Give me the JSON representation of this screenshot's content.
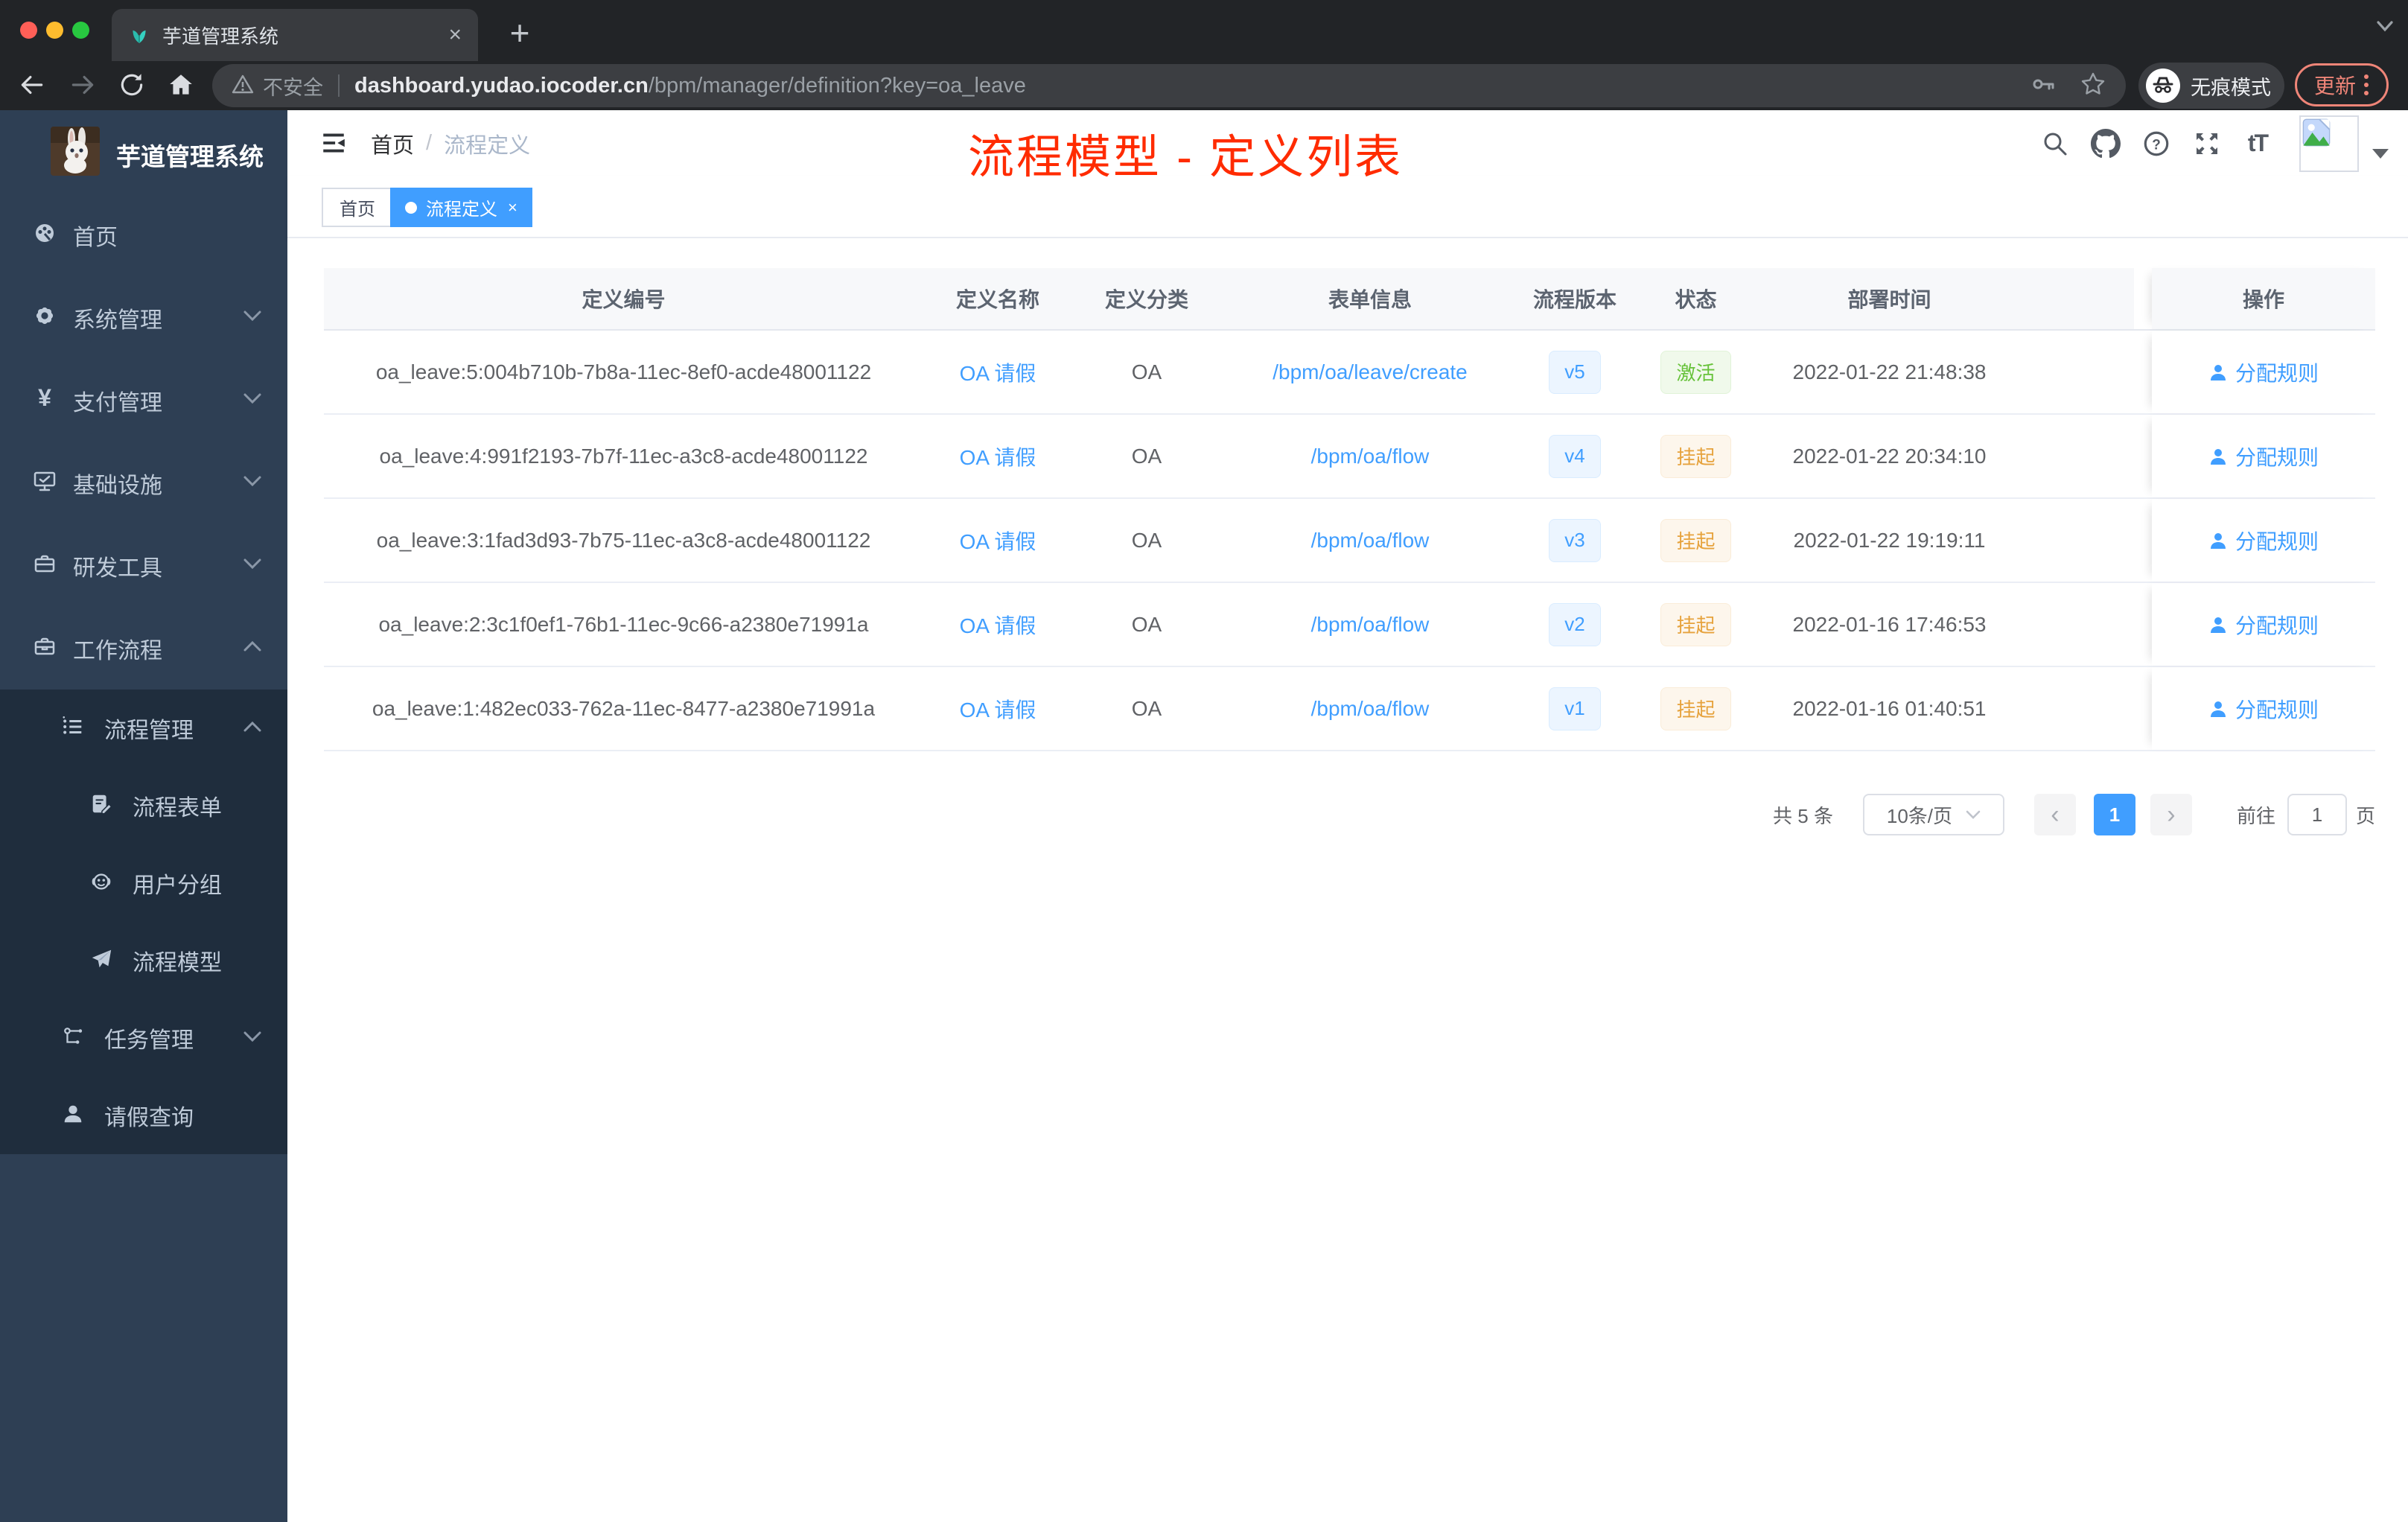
{
  "browser": {
    "tab_title": "芋道管理系统",
    "tab_close": "×",
    "new_tab": "+",
    "security_label": "不安全",
    "url_domain": "dashboard.yudao.iocoder.cn",
    "url_path": "/bpm/manager/definition?key=oa_leave",
    "incognito_label": "无痕模式",
    "update_label": "更新"
  },
  "sidebar": {
    "app_title": "芋道管理系统",
    "items": [
      {
        "label": "首页",
        "icon": "dashboard-icon"
      },
      {
        "label": "系统管理",
        "icon": "gear-icon"
      },
      {
        "label": "支付管理",
        "icon": "yen-icon"
      },
      {
        "label": "基础设施",
        "icon": "monitor-icon"
      },
      {
        "label": "研发工具",
        "icon": "toolbox-icon"
      },
      {
        "label": "工作流程",
        "icon": "briefcase-icon"
      }
    ],
    "submenu": [
      {
        "label": "流程管理",
        "icon": "list-icon"
      },
      {
        "label": "流程表单",
        "icon": "form-icon"
      },
      {
        "label": "用户分组",
        "icon": "robot-icon"
      },
      {
        "label": "流程模型",
        "icon": "paper-plane-icon"
      },
      {
        "label": "任务管理",
        "icon": "tree-icon"
      },
      {
        "label": "请假查询",
        "icon": "person-icon"
      }
    ]
  },
  "header": {
    "breadcrumb_home": "首页",
    "breadcrumb_sep": "/",
    "breadcrumb_current": "流程定义",
    "annotation": "流程模型 - 定义列表",
    "fontsize_glyph": "tT"
  },
  "tags": {
    "home": "首页",
    "active": "流程定义",
    "close": "×"
  },
  "table": {
    "columns": [
      "定义编号",
      "定义名称",
      "定义分类",
      "表单信息",
      "流程版本",
      "状态",
      "部署时间",
      "操作"
    ],
    "action_label": "分配规则",
    "rows": [
      {
        "id": "oa_leave:5:004b710b-7b8a-11ec-8ef0-acde48001122",
        "name": "OA 请假",
        "category": "OA",
        "form": "/bpm/oa/leave/create",
        "version": "v5",
        "status": "激活",
        "status_type": "success",
        "deploy_time": "2022-01-22 21:48:38",
        "action": "分配规则"
      },
      {
        "id": "oa_leave:4:991f2193-7b7f-11ec-a3c8-acde48001122",
        "name": "OA 请假",
        "category": "OA",
        "form": "/bpm/oa/flow",
        "version": "v4",
        "status": "挂起",
        "status_type": "warning",
        "deploy_time": "2022-01-22 20:34:10",
        "action": "分配规则"
      },
      {
        "id": "oa_leave:3:1fad3d93-7b75-11ec-a3c8-acde48001122",
        "name": "OA 请假",
        "category": "OA",
        "form": "/bpm/oa/flow",
        "version": "v3",
        "status": "挂起",
        "status_type": "warning",
        "deploy_time": "2022-01-22 19:19:11",
        "action": "分配规则"
      },
      {
        "id": "oa_leave:2:3c1f0ef1-76b1-11ec-9c66-a2380e71991a",
        "name": "OA 请假",
        "category": "OA",
        "form": "/bpm/oa/flow",
        "version": "v2",
        "status": "挂起",
        "status_type": "warning",
        "deploy_time": "2022-01-16 17:46:53",
        "action": "分配规则"
      },
      {
        "id": "oa_leave:1:482ec033-762a-11ec-8477-a2380e71991a",
        "name": "OA 请假",
        "category": "OA",
        "form": "/bpm/oa/flow",
        "version": "v1",
        "status": "挂起",
        "status_type": "warning",
        "deploy_time": "2022-01-16 01:40:51",
        "action": "分配规则"
      }
    ]
  },
  "pagination": {
    "total": "共 5 条",
    "page_size": "10条/页",
    "prev": "‹",
    "next": "›",
    "current_page": "1",
    "goto_label": "前往",
    "goto_value": "1",
    "page_unit": "页"
  },
  "colors": {
    "accent": "#409eff",
    "annotation_red": "#ff2b00",
    "sidebar_bg": "#2e3f54",
    "submenu_bg": "#1f2d3d",
    "success_text": "#67c23a",
    "warning_text": "#e6a23c"
  }
}
